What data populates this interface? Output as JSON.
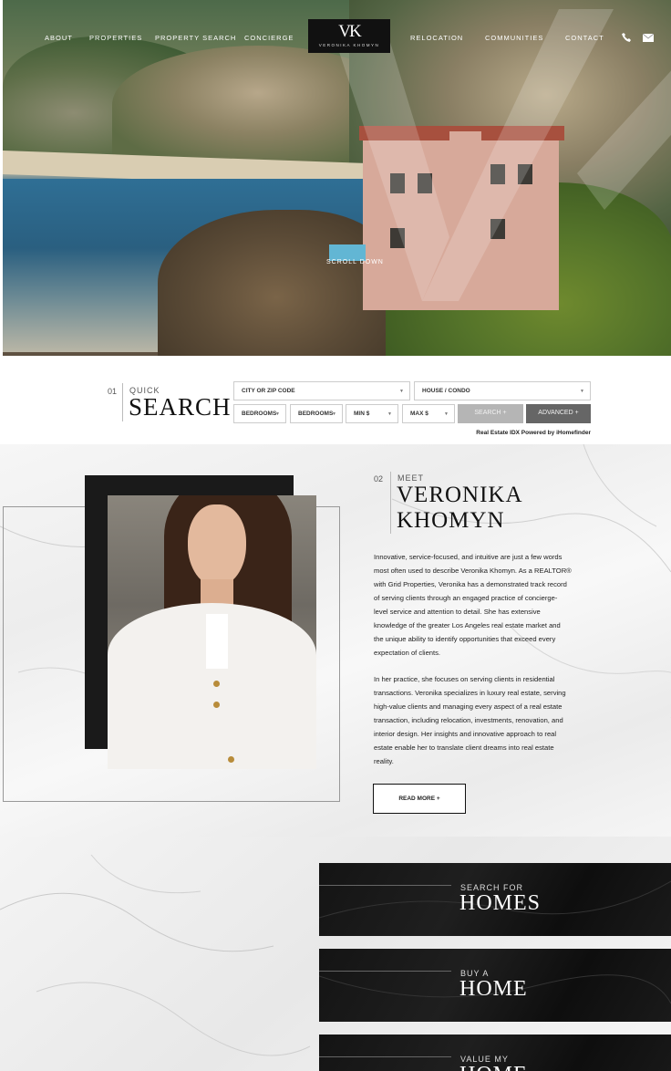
{
  "nav": {
    "items": [
      "About",
      "Properties",
      "Property Search",
      "Concierge",
      "Relocation",
      "Communities",
      "Contact"
    ],
    "logo_monogram": "VK",
    "logo_name": "Veronika Khomyn"
  },
  "hero": {
    "scroll_label": "SCROLL DOWN"
  },
  "quick_search": {
    "number": "01",
    "small": "Quick",
    "big": "Search",
    "city_placeholder": "CITY OR ZIP CODE",
    "type_value": "HOUSE / CONDO",
    "bedrooms_min": "BEDROOMS",
    "bedrooms_max": "BEDROOMS",
    "min_price": "MIN $",
    "max_price": "MAX $",
    "search_label": "SEARCH +",
    "advanced_label": "ADVANCED +",
    "idx_note": "Real Estate IDX Powered by iHomefinder"
  },
  "about": {
    "number": "02",
    "small": "Meet",
    "name_line1": "Veronika",
    "name_line2": "Khomyn",
    "bio1_lines": [
      "Innovative, service-focused, and intuitive are just a few words",
      "most often used to describe Veronika Khomyn. As a REALTOR®",
      "with Grid Properties, Veronika has a demonstrated track record",
      "of serving clients through an engaged practice of concierge-",
      "level service and attention to detail. She has extensive",
      "knowledge of the greater Los Angeles real estate market and",
      "the unique ability to identify opportunities that exceed every",
      "expectation of clients."
    ],
    "bio2_lines": [
      "In her practice, she focuses on serving clients in residential",
      "transactions. Veronika specializes in luxury real estate, serving",
      "high-value clients and managing every aspect of a real estate",
      "transaction, including relocation, investments, renovation, and",
      "interior design. Her insights and innovative approach to real",
      "estate enable her to translate client dreams into real estate",
      "reality."
    ],
    "read_more": "READ MORE +"
  },
  "ctas": [
    {
      "small": "Search for",
      "big": "Homes"
    },
    {
      "small": "Buy a",
      "big": "Home"
    },
    {
      "small": "Value my",
      "big": "Home"
    }
  ],
  "colors": {
    "dark": "#111111",
    "accent_gray": "#666666",
    "search_btn": "#b5b5b5"
  }
}
